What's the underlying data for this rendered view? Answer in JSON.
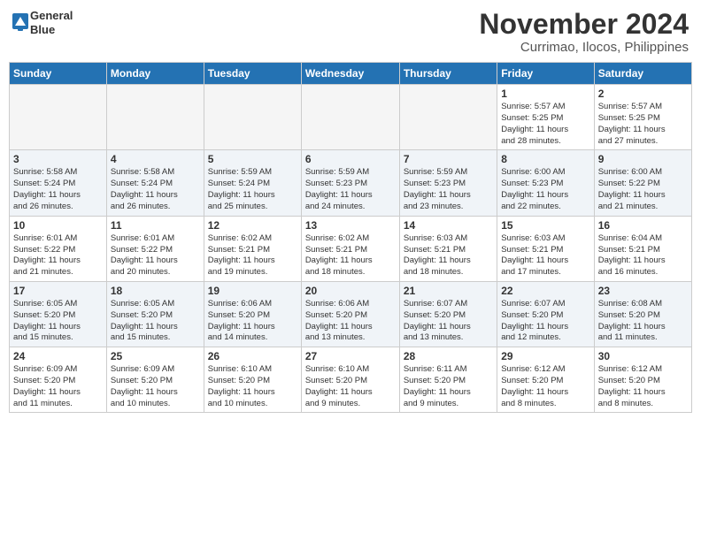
{
  "header": {
    "logo_line1": "General",
    "logo_line2": "Blue",
    "month": "November 2024",
    "location": "Currimao, Ilocos, Philippines"
  },
  "weekdays": [
    "Sunday",
    "Monday",
    "Tuesday",
    "Wednesday",
    "Thursday",
    "Friday",
    "Saturday"
  ],
  "weeks": [
    [
      {
        "day": "",
        "info": ""
      },
      {
        "day": "",
        "info": ""
      },
      {
        "day": "",
        "info": ""
      },
      {
        "day": "",
        "info": ""
      },
      {
        "day": "",
        "info": ""
      },
      {
        "day": "1",
        "info": "Sunrise: 5:57 AM\nSunset: 5:25 PM\nDaylight: 11 hours\nand 28 minutes."
      },
      {
        "day": "2",
        "info": "Sunrise: 5:57 AM\nSunset: 5:25 PM\nDaylight: 11 hours\nand 27 minutes."
      }
    ],
    [
      {
        "day": "3",
        "info": "Sunrise: 5:58 AM\nSunset: 5:24 PM\nDaylight: 11 hours\nand 26 minutes."
      },
      {
        "day": "4",
        "info": "Sunrise: 5:58 AM\nSunset: 5:24 PM\nDaylight: 11 hours\nand 26 minutes."
      },
      {
        "day": "5",
        "info": "Sunrise: 5:59 AM\nSunset: 5:24 PM\nDaylight: 11 hours\nand 25 minutes."
      },
      {
        "day": "6",
        "info": "Sunrise: 5:59 AM\nSunset: 5:23 PM\nDaylight: 11 hours\nand 24 minutes."
      },
      {
        "day": "7",
        "info": "Sunrise: 5:59 AM\nSunset: 5:23 PM\nDaylight: 11 hours\nand 23 minutes."
      },
      {
        "day": "8",
        "info": "Sunrise: 6:00 AM\nSunset: 5:23 PM\nDaylight: 11 hours\nand 22 minutes."
      },
      {
        "day": "9",
        "info": "Sunrise: 6:00 AM\nSunset: 5:22 PM\nDaylight: 11 hours\nand 21 minutes."
      }
    ],
    [
      {
        "day": "10",
        "info": "Sunrise: 6:01 AM\nSunset: 5:22 PM\nDaylight: 11 hours\nand 21 minutes."
      },
      {
        "day": "11",
        "info": "Sunrise: 6:01 AM\nSunset: 5:22 PM\nDaylight: 11 hours\nand 20 minutes."
      },
      {
        "day": "12",
        "info": "Sunrise: 6:02 AM\nSunset: 5:21 PM\nDaylight: 11 hours\nand 19 minutes."
      },
      {
        "day": "13",
        "info": "Sunrise: 6:02 AM\nSunset: 5:21 PM\nDaylight: 11 hours\nand 18 minutes."
      },
      {
        "day": "14",
        "info": "Sunrise: 6:03 AM\nSunset: 5:21 PM\nDaylight: 11 hours\nand 18 minutes."
      },
      {
        "day": "15",
        "info": "Sunrise: 6:03 AM\nSunset: 5:21 PM\nDaylight: 11 hours\nand 17 minutes."
      },
      {
        "day": "16",
        "info": "Sunrise: 6:04 AM\nSunset: 5:21 PM\nDaylight: 11 hours\nand 16 minutes."
      }
    ],
    [
      {
        "day": "17",
        "info": "Sunrise: 6:05 AM\nSunset: 5:20 PM\nDaylight: 11 hours\nand 15 minutes."
      },
      {
        "day": "18",
        "info": "Sunrise: 6:05 AM\nSunset: 5:20 PM\nDaylight: 11 hours\nand 15 minutes."
      },
      {
        "day": "19",
        "info": "Sunrise: 6:06 AM\nSunset: 5:20 PM\nDaylight: 11 hours\nand 14 minutes."
      },
      {
        "day": "20",
        "info": "Sunrise: 6:06 AM\nSunset: 5:20 PM\nDaylight: 11 hours\nand 13 minutes."
      },
      {
        "day": "21",
        "info": "Sunrise: 6:07 AM\nSunset: 5:20 PM\nDaylight: 11 hours\nand 13 minutes."
      },
      {
        "day": "22",
        "info": "Sunrise: 6:07 AM\nSunset: 5:20 PM\nDaylight: 11 hours\nand 12 minutes."
      },
      {
        "day": "23",
        "info": "Sunrise: 6:08 AM\nSunset: 5:20 PM\nDaylight: 11 hours\nand 11 minutes."
      }
    ],
    [
      {
        "day": "24",
        "info": "Sunrise: 6:09 AM\nSunset: 5:20 PM\nDaylight: 11 hours\nand 11 minutes."
      },
      {
        "day": "25",
        "info": "Sunrise: 6:09 AM\nSunset: 5:20 PM\nDaylight: 11 hours\nand 10 minutes."
      },
      {
        "day": "26",
        "info": "Sunrise: 6:10 AM\nSunset: 5:20 PM\nDaylight: 11 hours\nand 10 minutes."
      },
      {
        "day": "27",
        "info": "Sunrise: 6:10 AM\nSunset: 5:20 PM\nDaylight: 11 hours\nand 9 minutes."
      },
      {
        "day": "28",
        "info": "Sunrise: 6:11 AM\nSunset: 5:20 PM\nDaylight: 11 hours\nand 9 minutes."
      },
      {
        "day": "29",
        "info": "Sunrise: 6:12 AM\nSunset: 5:20 PM\nDaylight: 11 hours\nand 8 minutes."
      },
      {
        "day": "30",
        "info": "Sunrise: 6:12 AM\nSunset: 5:20 PM\nDaylight: 11 hours\nand 8 minutes."
      }
    ]
  ]
}
